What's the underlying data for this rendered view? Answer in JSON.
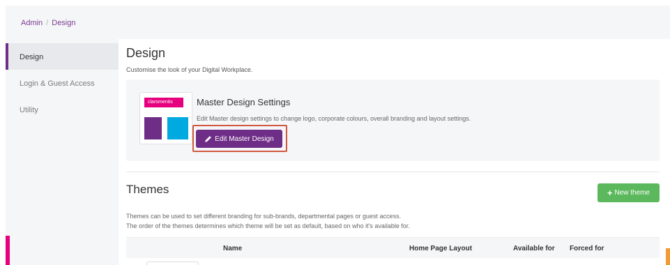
{
  "breadcrumb": {
    "root": "Admin",
    "separator": "/",
    "current": "Design"
  },
  "sidebar": {
    "items": [
      {
        "label": "Design",
        "active": true
      },
      {
        "label": "Login & Guest Access",
        "active": false
      },
      {
        "label": "Utility",
        "active": false
      }
    ]
  },
  "page": {
    "title": "Design",
    "subtitle": "Customise the look of your Digital Workplace."
  },
  "master": {
    "thumbnail_logo": "claromentis",
    "title": "Master Design Settings",
    "description": "Edit Master design settings to change logo, corporate colours, overall branding and layout settings.",
    "edit_label": "Edit Master Design",
    "edit_icon": "pencil-icon"
  },
  "themes": {
    "title": "Themes",
    "new_label": "New theme",
    "new_icon": "plus-icon",
    "desc_line1": "Themes can be used to set different branding for sub-brands, departmental pages or guest access.",
    "desc_line2": "The order of the themes determines which theme will be set as default, based on who it's available for.",
    "columns": [
      "Name",
      "Home Page Layout",
      "Available for",
      "Forced for"
    ]
  },
  "colors": {
    "brand_purple": "#6e2d86",
    "brand_pink": "#e6007e",
    "brand_cyan": "#00a9e0",
    "success_green": "#5cb85c",
    "highlight_red": "#d1573f"
  }
}
